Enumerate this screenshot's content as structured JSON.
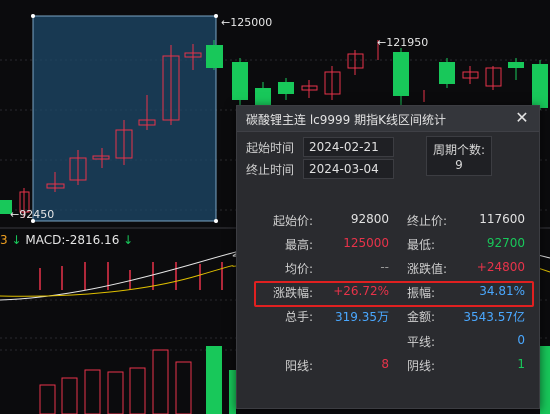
{
  "chart": {
    "high_marker": "125000",
    "mid_marker": "121950",
    "low_marker": "92450",
    "left_edge_digit": "3"
  },
  "macd": {
    "index_digit": "3",
    "text": "MACD:-2816.16",
    "arrow1": "↓",
    "arrow2": "↓"
  },
  "dialog": {
    "title": "碳酸锂主连  lc9999  期指K线区间统计",
    "close_glyph": "✕",
    "start_time_label": "起始时间",
    "start_time_value": "2024-02-21",
    "end_time_label": "终止时间",
    "end_time_value": "2024-03-04",
    "period_label": "周期个数:",
    "period_value": "9",
    "rows": [
      {
        "l1": "起始价:",
        "v1": "92800",
        "l2": "终止价:",
        "v2": "117600"
      },
      {
        "l1": "最高:",
        "v1": "125000",
        "l2": "最低:",
        "v2": "92700"
      },
      {
        "l1": "均价:",
        "v1": "--",
        "l2": "涨跌值:",
        "v2": "+24800"
      },
      {
        "l1": "涨跌幅:",
        "v1": "+26.72%",
        "l2": "振幅:",
        "v2": "34.81%"
      },
      {
        "l1": "总手:",
        "v1": "319.35万",
        "l2": "金额:",
        "v2": "3543.57亿"
      },
      {
        "l1": "",
        "v1": "",
        "l2": "平线:",
        "v2": "0"
      },
      {
        "l1": "阳线:",
        "v1": "8",
        "l2": "阴线:",
        "v2": "1"
      }
    ]
  },
  "colors": {
    "up": "#e8334a",
    "down": "#18c85a",
    "selection": "#1e4a6a",
    "highlight_border": "#e02020"
  },
  "icons": [
    "close-icon",
    "down-arrow-icon"
  ]
}
